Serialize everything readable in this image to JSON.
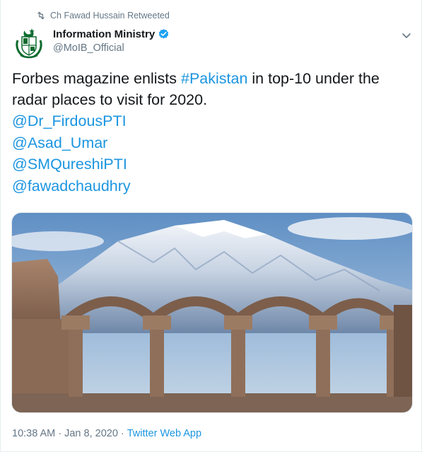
{
  "retweet": {
    "label": "Ch Fawad Hussain Retweeted",
    "icon": "retweet-icon"
  },
  "author": {
    "display_name": "Information Ministry",
    "handle": "@MoIB_Official",
    "verified": true,
    "avatar_icon": "pakistan-emblem-icon"
  },
  "tweet": {
    "text_before": "Forbes magazine enlists ",
    "hashtag": "#Pakistan",
    "text_after": " in top-10 under the radar places to visit for 2020.",
    "mentions": [
      "@Dr_FirdousPTI",
      "@Asad_Umar",
      "@SMQureshiPTI",
      "@fawadchaudhry"
    ]
  },
  "media": {
    "kind": "photo"
  },
  "meta": {
    "time": "10:38 AM",
    "separator": "·",
    "date": "Jan 8, 2020",
    "app": "Twitter Web App"
  },
  "colors": {
    "link": "#1b95e0",
    "text": "#14171a",
    "secondary": "#657786",
    "verified": "#1da1f2"
  }
}
